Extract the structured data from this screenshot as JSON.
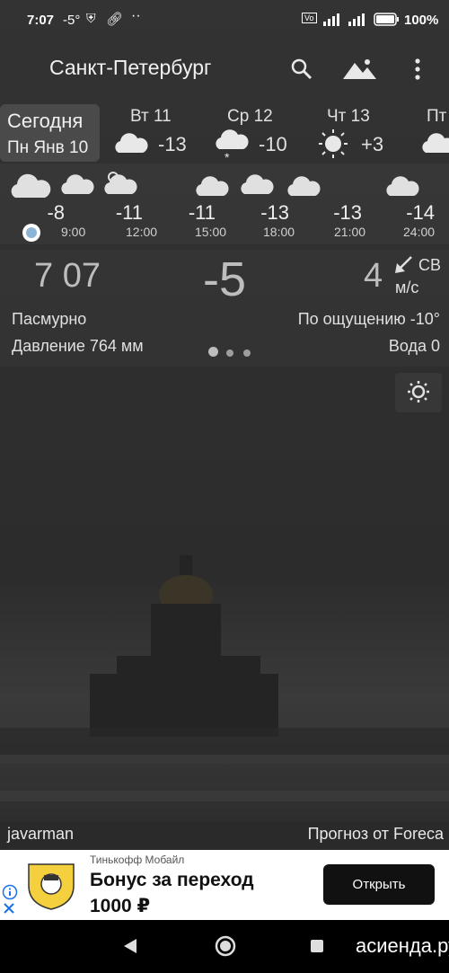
{
  "status": {
    "time": "7:07",
    "temp": "-5°",
    "battery": "100%"
  },
  "header": {
    "city": "Санкт-Петербург"
  },
  "days": [
    {
      "label": "Сегодня",
      "date": "Пн Янв 10"
    },
    {
      "label": "Вт 11",
      "temp": "-13"
    },
    {
      "label": "Ср 12",
      "temp": "-10"
    },
    {
      "label": "Чт 13",
      "temp": "+3"
    },
    {
      "label": "Пт"
    }
  ],
  "hourly": [
    {
      "temp": "-8",
      "time": "9:00"
    },
    {
      "temp": "-11",
      "time": "12:00"
    },
    {
      "temp": "-11",
      "time": "15:00"
    },
    {
      "temp": "-13",
      "time": "18:00"
    },
    {
      "temp": "-13",
      "time": "21:00"
    },
    {
      "temp": "-14",
      "time": "24:00"
    }
  ],
  "current": {
    "clock": "7 07",
    "temp": "-5",
    "wind_speed": "4",
    "wind_dir": "СВ",
    "wind_unit": "м/с",
    "condition": "Пасмурно",
    "feels_like": "По ощущению -10°",
    "pressure": "Давление 764 мм",
    "water": "Вода 0"
  },
  "footer": {
    "author": "javarman",
    "provider": "Прогноз от Foreca"
  },
  "ad": {
    "brand": "Тинькофф Мобайл",
    "title": "Бонус за переход",
    "amount": "1000 ₽",
    "button": "Открыть"
  },
  "watermark": "асиенда.ру"
}
